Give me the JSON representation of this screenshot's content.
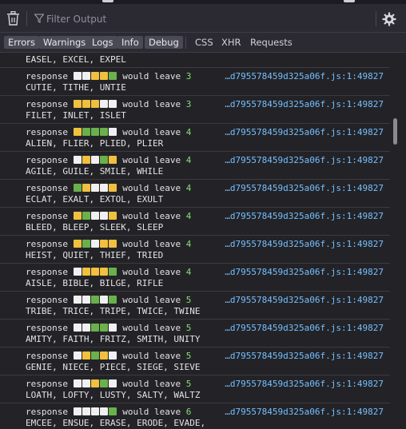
{
  "toolbar": {
    "filter_placeholder": "Filter Output"
  },
  "filters": [
    {
      "label": "Errors",
      "active": true
    },
    {
      "label": "Warnings",
      "active": true
    },
    {
      "label": "Logs",
      "active": true
    },
    {
      "label": "Info",
      "active": true
    },
    {
      "label": "Debug",
      "active": true
    },
    {
      "label": "CSS",
      "active": false
    },
    {
      "label": "XHR",
      "active": false
    },
    {
      "label": "Requests",
      "active": false
    }
  ],
  "colors": {
    "white": "#f0f0f0",
    "yellow": "#f0c03e",
    "green": "#6ab04c",
    "link": "#75bfff",
    "number": "#86de74"
  },
  "log": {
    "top_partial": "EASEL, EXCEL, EXPEL",
    "entries": [
      {
        "prefix": "response",
        "squares": [
          "w",
          "w",
          "y",
          "y",
          "g"
        ],
        "text": "would leave",
        "count": "3",
        "words": "CUTIE, TITHE, UNTIE",
        "source": "…d795578459d325a06f.js:1:49827"
      },
      {
        "prefix": "response",
        "squares": [
          "y",
          "y",
          "y",
          "w",
          "w"
        ],
        "text": "would leave",
        "count": "3",
        "words": "FILET, INLET, ISLET",
        "source": "…d795578459d325a06f.js:1:49827"
      },
      {
        "prefix": "response",
        "squares": [
          "y",
          "g",
          "g",
          "g",
          "w"
        ],
        "text": "would leave",
        "count": "4",
        "words": "ALIEN, FLIER, PLIED, PLIER",
        "source": "…d795578459d325a06f.js:1:49827"
      },
      {
        "prefix": "response",
        "squares": [
          "w",
          "y",
          "w",
          "g",
          "y"
        ],
        "text": "would leave",
        "count": "4",
        "words": "AGILE, GUILE, SMILE, WHILE",
        "source": "…d795578459d325a06f.js:1:49827"
      },
      {
        "prefix": "response",
        "squares": [
          "g",
          "y",
          "w",
          "w",
          "y"
        ],
        "text": "would leave",
        "count": "4",
        "words": "ECLAT, EXALT, EXTOL, EXULT",
        "source": "…d795578459d325a06f.js:1:49827"
      },
      {
        "prefix": "response",
        "squares": [
          "y",
          "g",
          "w",
          "w",
          "y"
        ],
        "text": "would leave",
        "count": "4",
        "words": "BLEED, BLEEP, SLEEK, SLEEP",
        "source": "…d795578459d325a06f.js:1:49827"
      },
      {
        "prefix": "response",
        "squares": [
          "y",
          "g",
          "w",
          "y",
          "y"
        ],
        "text": "would leave",
        "count": "4",
        "words": "HEIST, QUIET, THIEF, TRIED",
        "source": "…d795578459d325a06f.js:1:49827"
      },
      {
        "prefix": "response",
        "squares": [
          "w",
          "y",
          "y",
          "y",
          "g"
        ],
        "text": "would leave",
        "count": "4",
        "words": "AISLE, BIBLE, BILGE, RIFLE",
        "source": "…d795578459d325a06f.js:1:49827"
      },
      {
        "prefix": "response",
        "squares": [
          "w",
          "w",
          "g",
          "w",
          "g"
        ],
        "text": "would leave",
        "count": "5",
        "words": "TRIBE, TRICE, TRIPE, TWICE, TWINE",
        "source": "…d795578459d325a06f.js:1:49827"
      },
      {
        "prefix": "response",
        "squares": [
          "w",
          "w",
          "g",
          "g",
          "w"
        ],
        "text": "would leave",
        "count": "5",
        "words": "AMITY, FAITH, FRITZ, SMITH, UNITY",
        "source": "…d795578459d325a06f.js:1:49827"
      },
      {
        "prefix": "response",
        "squares": [
          "w",
          "y",
          "g",
          "y",
          "w"
        ],
        "text": "would leave",
        "count": "5",
        "words": "GENIE, NIECE, PIECE, SIEGE, SIEVE",
        "source": "…d795578459d325a06f.js:1:49827"
      },
      {
        "prefix": "response",
        "squares": [
          "w",
          "w",
          "y",
          "g",
          "w"
        ],
        "text": "would leave",
        "count": "5",
        "words": "LOATH, LOFTY, LUSTY, SALTY, WALTZ",
        "source": "…d795578459d325a06f.js:1:49827"
      },
      {
        "prefix": "response",
        "squares": [
          "w",
          "w",
          "w",
          "w",
          "g"
        ],
        "text": "would leave",
        "count": "6",
        "words": "EMCEE, ENSUE, ERASE, ERODE, EVADE,",
        "source": "…d795578459d325a06f.js:1:49827"
      }
    ]
  }
}
